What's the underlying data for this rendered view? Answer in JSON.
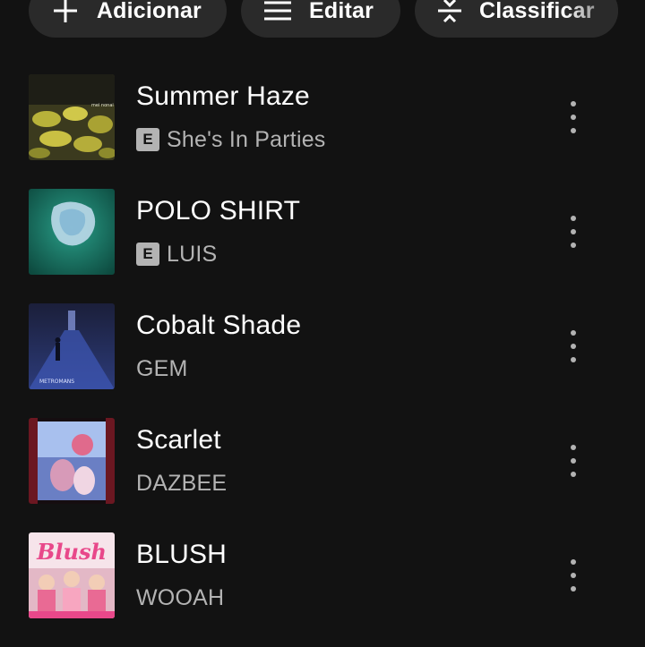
{
  "toolbar": {
    "add_label": "Adicionar",
    "edit_label": "Editar",
    "sort_label": "Classificar"
  },
  "explicit_badge": "E",
  "tracks": [
    {
      "title": "Summer Haze",
      "artist": "She's In Parties",
      "explicit": true
    },
    {
      "title": "POLO SHIRT",
      "artist": "LUIS",
      "explicit": true
    },
    {
      "title": "Cobalt Shade",
      "artist": "GEM",
      "explicit": false
    },
    {
      "title": "Scarlet",
      "artist": "DAZBEE",
      "explicit": false
    },
    {
      "title": "BLUSH",
      "artist": "WOOAH",
      "explicit": false
    }
  ],
  "cover_text": {
    "cover_1": "mei nonai",
    "cover_3": "METROMANS",
    "cover_5": "Blush"
  },
  "icons": {
    "add": "plus-icon",
    "edit": "list-icon",
    "sort": "sort-icon",
    "more": "more-vertical-icon"
  },
  "colors": {
    "background": "#121212",
    "pill": "#2a2a2a",
    "primary_text": "#ffffff",
    "secondary_text": "#b3b3b3"
  }
}
